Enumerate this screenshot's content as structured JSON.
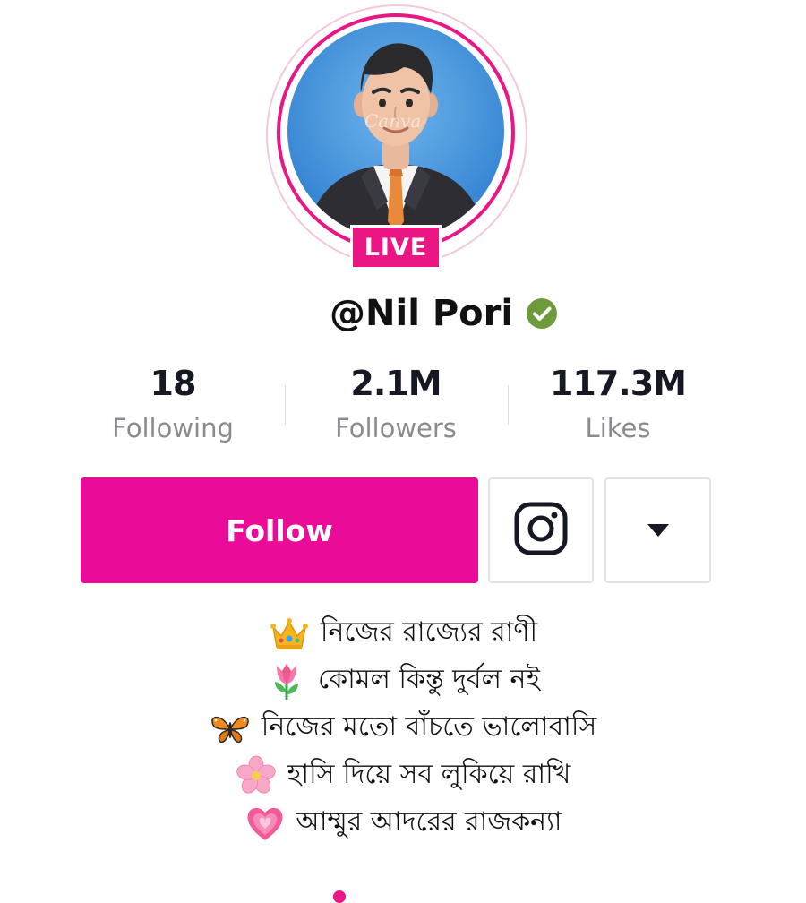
{
  "profile": {
    "live_label": "LIVE",
    "username": "@Nil Pori",
    "avatar_watermark": "Canva",
    "verified_icon": "verified-check-icon"
  },
  "stats": [
    {
      "value": "18",
      "label": "Following"
    },
    {
      "value": "2.1M",
      "label": "Followers"
    },
    {
      "value": "117.3M",
      "label": "Likes"
    }
  ],
  "actions": {
    "follow_label": "Follow",
    "instagram_icon": "instagram-icon",
    "more_icon": "caret-down-icon"
  },
  "bio": [
    {
      "icon": "crown-icon",
      "text": "নিজের রাজ্যের রাণী"
    },
    {
      "icon": "tulip-icon",
      "text": "কোমল কিন্তু দুর্বল নই"
    },
    {
      "icon": "butterfly-icon",
      "text": "নিজের মতো বাঁচতে ভালোবাসি"
    },
    {
      "icon": "cherry-blossom-icon",
      "text": "হাসি দিয়ে সব লুকিয়ে রাখি"
    },
    {
      "icon": "heart-icon",
      "text": "আম্মুর আদরের রাজকন্যা"
    }
  ],
  "colors": {
    "accent_pink": "#ea0b99",
    "live_pink": "#ea1683",
    "verified_green": "#6d9a3a",
    "stat_label_gray": "#8a8b91"
  }
}
